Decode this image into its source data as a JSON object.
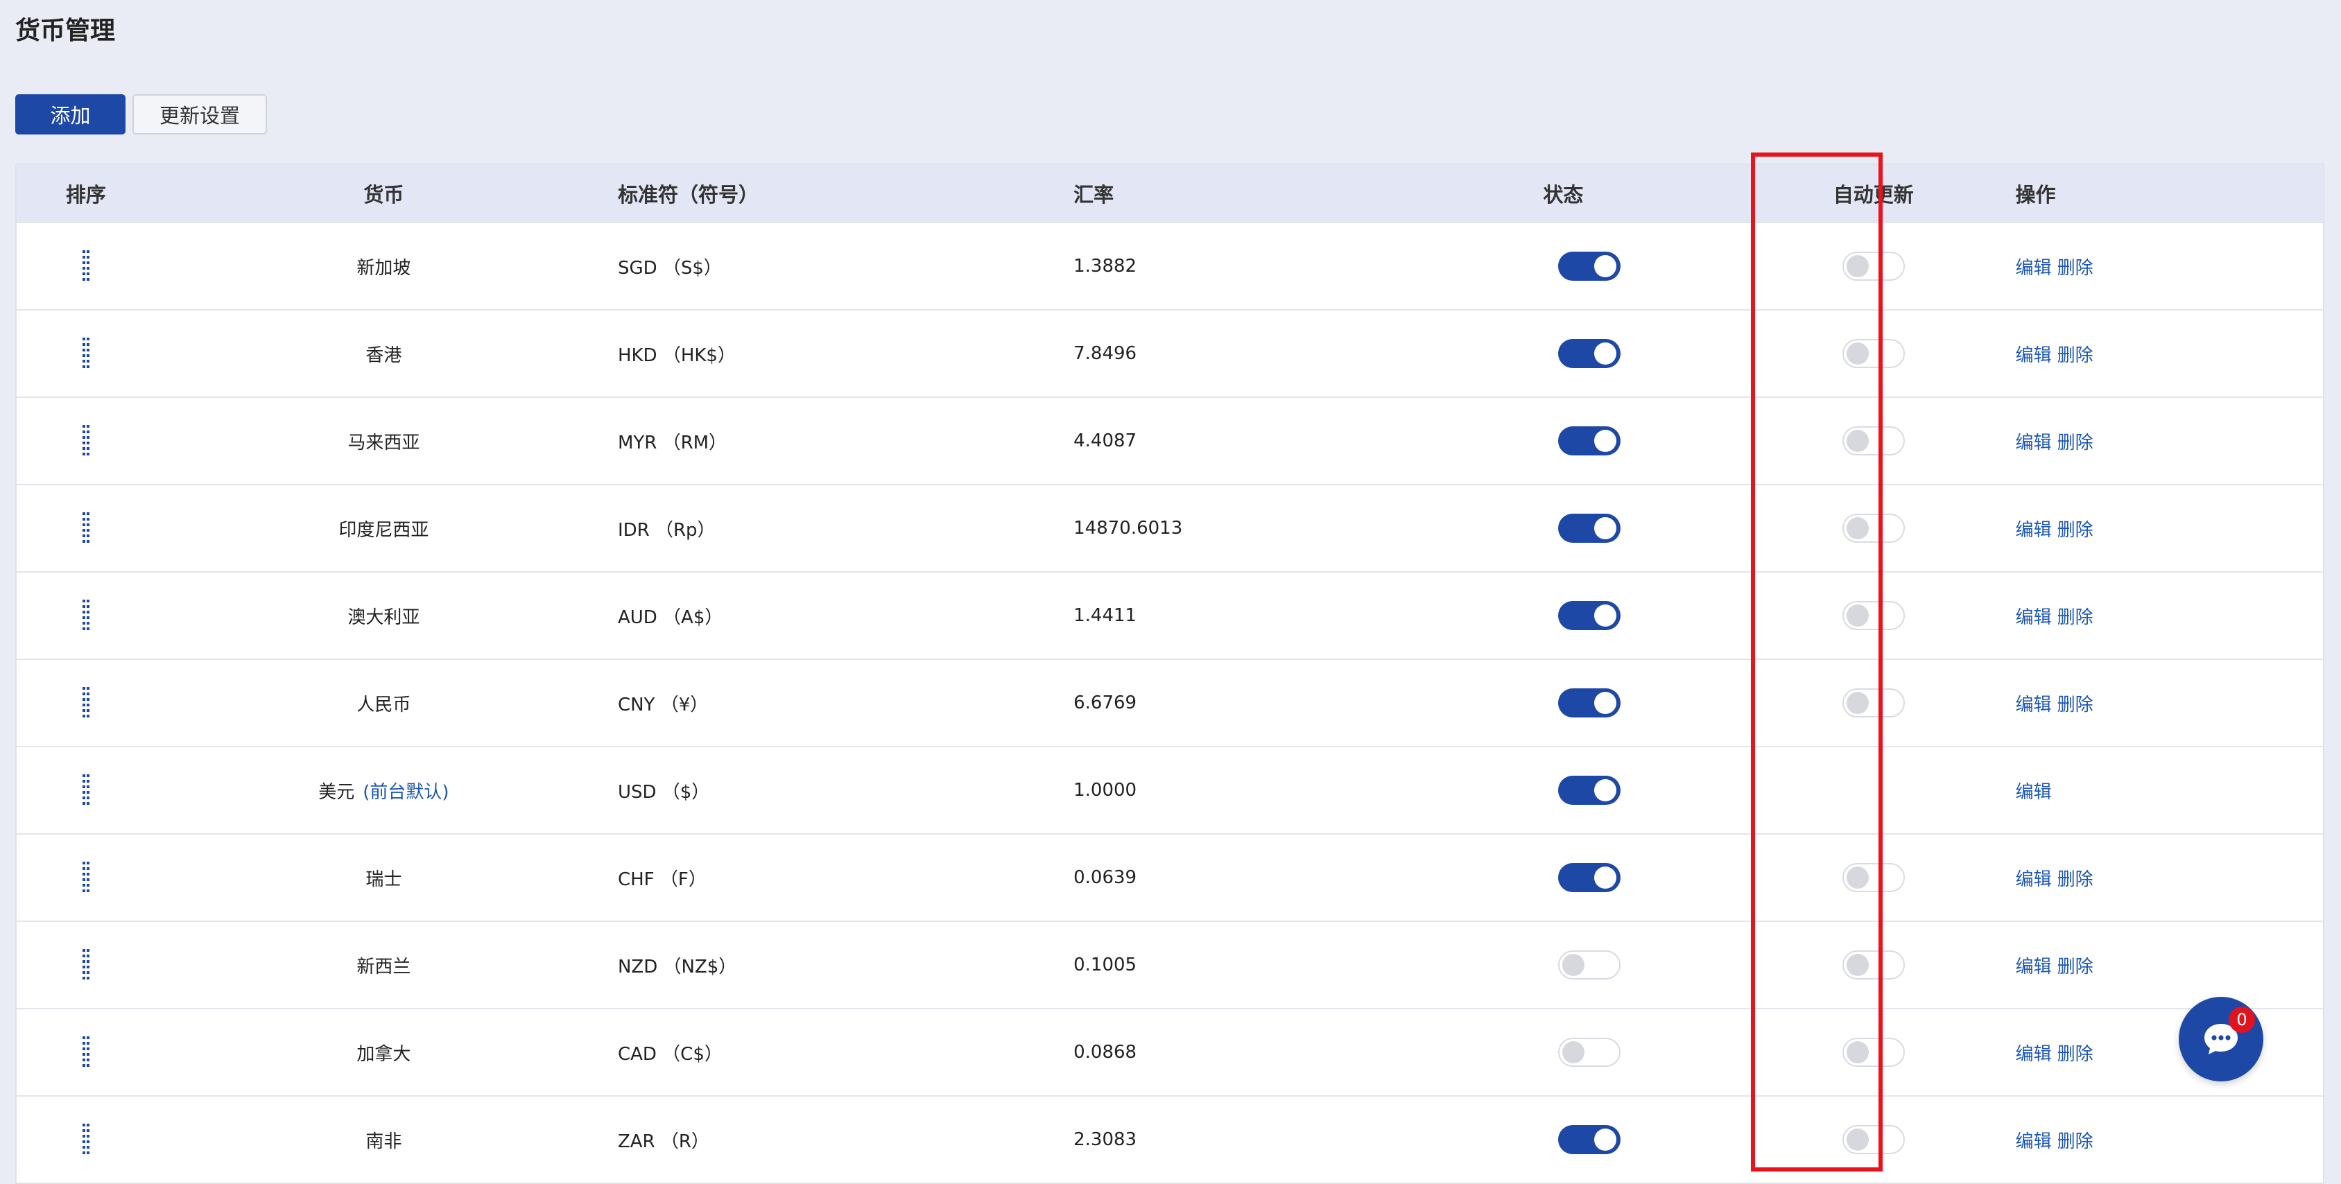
{
  "page": {
    "title": "货币管理"
  },
  "toolbar": {
    "add_label": "添加",
    "update_settings_label": "更新设置"
  },
  "table": {
    "headers": {
      "sort": "排序",
      "currency": "货币",
      "symbol": "标准符（符号）",
      "rate": "汇率",
      "status": "状态",
      "auto_update": "自动更新",
      "ops": "操作"
    },
    "actions": {
      "edit": "编辑",
      "delete": "删除"
    },
    "rows": [
      {
        "currency": "新加坡",
        "symbol": "SGD （S$）",
        "rate": "1.3882",
        "status_on": true,
        "auto_update_on": false,
        "show_auto": true,
        "show_delete": true,
        "default_tag": ""
      },
      {
        "currency": "香港",
        "symbol": "HKD （HK$）",
        "rate": "7.8496",
        "status_on": true,
        "auto_update_on": false,
        "show_auto": true,
        "show_delete": true,
        "default_tag": ""
      },
      {
        "currency": "马来西亚",
        "symbol": "MYR （RM）",
        "rate": "4.4087",
        "status_on": true,
        "auto_update_on": false,
        "show_auto": true,
        "show_delete": true,
        "default_tag": ""
      },
      {
        "currency": "印度尼西亚",
        "symbol": "IDR （Rp）",
        "rate": "14870.6013",
        "status_on": true,
        "auto_update_on": false,
        "show_auto": true,
        "show_delete": true,
        "default_tag": ""
      },
      {
        "currency": "澳大利亚",
        "symbol": "AUD （A$）",
        "rate": "1.4411",
        "status_on": true,
        "auto_update_on": false,
        "show_auto": true,
        "show_delete": true,
        "default_tag": ""
      },
      {
        "currency": "人民币",
        "symbol": "CNY （¥）",
        "rate": "6.6769",
        "status_on": true,
        "auto_update_on": false,
        "show_auto": true,
        "show_delete": true,
        "default_tag": ""
      },
      {
        "currency": "美元",
        "symbol": "USD （$）",
        "rate": "1.0000",
        "status_on": true,
        "auto_update_on": false,
        "show_auto": false,
        "show_delete": false,
        "default_tag": "(前台默认)"
      },
      {
        "currency": "瑞士",
        "symbol": "CHF （F）",
        "rate": "0.0639",
        "status_on": true,
        "auto_update_on": false,
        "show_auto": true,
        "show_delete": true,
        "default_tag": ""
      },
      {
        "currency": "新西兰",
        "symbol": "NZD （NZ$）",
        "rate": "0.1005",
        "status_on": false,
        "auto_update_on": false,
        "show_auto": true,
        "show_delete": true,
        "default_tag": ""
      },
      {
        "currency": "加拿大",
        "symbol": "CAD （C$）",
        "rate": "0.0868",
        "status_on": false,
        "auto_update_on": false,
        "show_auto": true,
        "show_delete": true,
        "default_tag": ""
      },
      {
        "currency": "南非",
        "symbol": "ZAR （R）",
        "rate": "2.3083",
        "status_on": true,
        "auto_update_on": false,
        "show_auto": true,
        "show_delete": true,
        "default_tag": ""
      }
    ]
  },
  "chat": {
    "icon": "chat-bubble-icon",
    "badge_count": "0"
  },
  "colors": {
    "primary": "#1d48a5",
    "link": "#1d57b5",
    "highlight": "#e8131c",
    "badge": "#e0141f",
    "header_bg": "#e3e6f5",
    "page_bg": "#e9ecf4"
  }
}
